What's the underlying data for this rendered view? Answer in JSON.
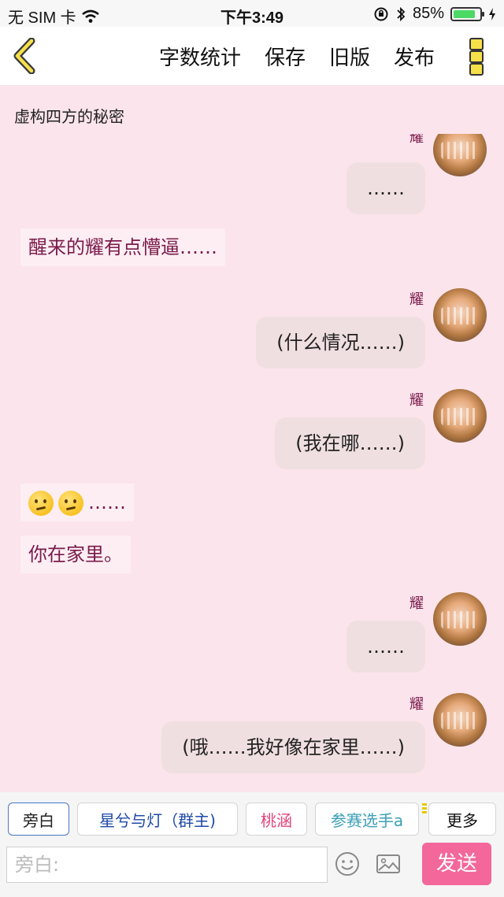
{
  "status_bar": {
    "carrier": "无 SIM 卡",
    "time": "下午3:49",
    "battery_percent": "85%",
    "battery_level": 0.85,
    "battery_color": "#4cd964"
  },
  "nav": {
    "back_icon": "chevron-left-icon",
    "actions": [
      "字数统计",
      "保存",
      "旧版",
      "发布"
    ],
    "menu_icon": "more-vertical-icon"
  },
  "chat": {
    "title": "虚构四方的秘密",
    "messages": [
      {
        "type": "right",
        "name": "耀",
        "text": "……"
      },
      {
        "type": "narration",
        "text": "醒来的耀有点懵逼……"
      },
      {
        "type": "right",
        "name": "耀",
        "text": "(什么情况……)"
      },
      {
        "type": "right",
        "name": "耀",
        "text": "(我在哪……)"
      },
      {
        "type": "narration",
        "emoji": "thinking-face-icon",
        "text": "……"
      },
      {
        "type": "narration",
        "text": "你在家里。"
      },
      {
        "type": "right",
        "name": "耀",
        "text": "……"
      },
      {
        "type": "right",
        "name": "耀",
        "text": "(哦……我好像在家里……)"
      }
    ]
  },
  "bottom": {
    "roles": [
      {
        "label": "旁白",
        "color": "#222222",
        "selected": true
      },
      {
        "label": "星兮与灯（群主)",
        "color": "#1f4aa8",
        "selected": false
      },
      {
        "label": "桃涵",
        "color": "#e0457b",
        "selected": false
      },
      {
        "label": "参赛选手a",
        "color": "#3a9fb6",
        "selected": false
      }
    ],
    "more_label": "更多",
    "input_placeholder": "旁白:",
    "emoji_icon": "smiley-icon",
    "image_icon": "image-icon",
    "send_label": "发送",
    "send_color": "#f3679b"
  }
}
